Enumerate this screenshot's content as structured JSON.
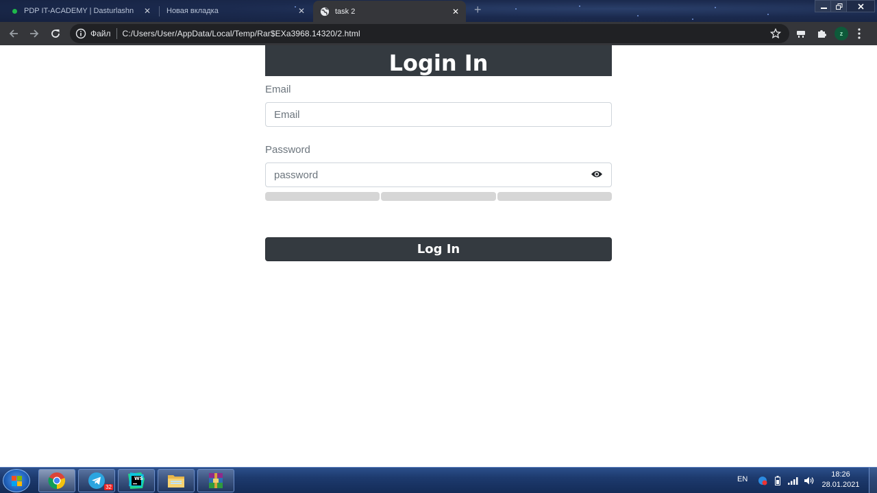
{
  "browser": {
    "tabs": [
      {
        "title": "PDP IT-ACADEMY | Dasturlashni"
      },
      {
        "title": "Новая вкладка"
      },
      {
        "title": "task 2"
      }
    ],
    "scheme_label": "Файл",
    "url": "C:/Users/User/AppData/Local/Temp/Rar$EXa3968.14320/2.html",
    "profile_initial": "z"
  },
  "page": {
    "heading": "Login In",
    "email_label": "Email",
    "email_placeholder": "Email",
    "password_label": "Password",
    "password_placeholder": "password",
    "strength_segments": 3,
    "login_button": "Log In"
  },
  "taskbar": {
    "telegram_badge": "32",
    "webstorm_label": "WS",
    "language": "EN",
    "time": "18:26",
    "date": "28.01.2021"
  },
  "colors": {
    "accent_dark": "#343a40",
    "chrome_dark": "#35363a",
    "strength_empty": "#d6d6d6"
  }
}
